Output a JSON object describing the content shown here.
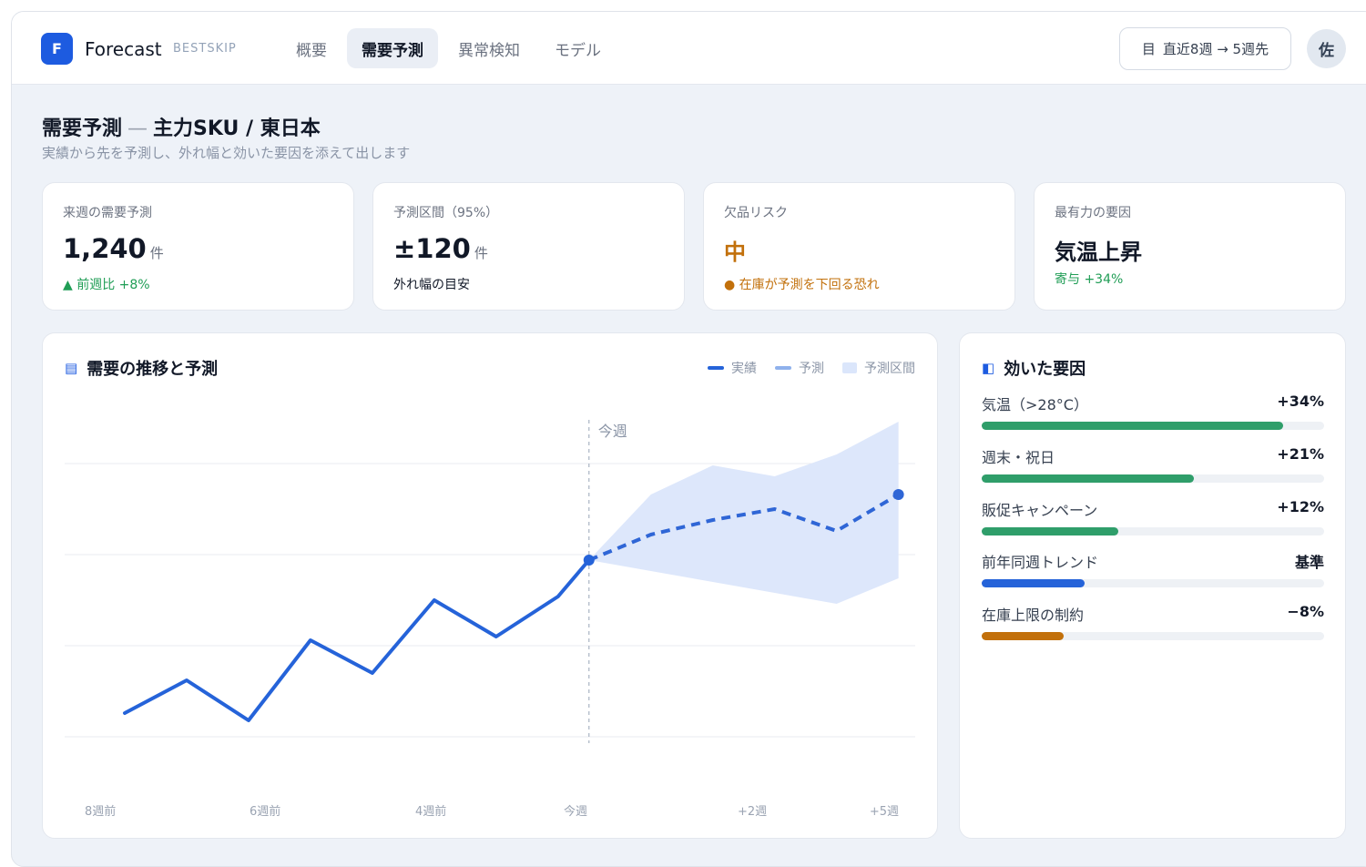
{
  "app": {
    "logo_letter": "F",
    "name": "Forecast",
    "subtitle": "BESTSKIP",
    "avatar": "佐"
  },
  "nav": {
    "tabs": [
      {
        "label": "概要",
        "active": false
      },
      {
        "label": "需要予測",
        "active": true
      },
      {
        "label": "異常検知",
        "active": false
      },
      {
        "label": "モデル",
        "active": false
      }
    ],
    "range_icon": "目",
    "range_label": "直近8週 → 5週先"
  },
  "page": {
    "title_main": "需要予測",
    "title_dash": "—",
    "title_scope": "主力SKU / 東日本",
    "subtitle": "実績から先を予測し、外れ幅と効いた要因を添えて出します"
  },
  "kpis": [
    {
      "label": "来週の需要予測",
      "value": "1,240",
      "unit": "件",
      "note": "▲ 前週比 +8%"
    },
    {
      "label": "予測区間（95%）",
      "value": "±120",
      "unit": "件",
      "note": "外れ幅の目安"
    },
    {
      "label": "欠品リスク",
      "value": "中",
      "note": "● 在庫が予測を下回る恐れ"
    },
    {
      "label": "最有力の要因",
      "value": "気温上昇",
      "note": "寄与 +34%"
    }
  ],
  "trend_panel": {
    "icon": "▤",
    "title": "需要の推移と予測",
    "legend": {
      "actual": "実績",
      "forecast": "予測",
      "interval": "予測区間"
    },
    "now_marker": "今週"
  },
  "factor_panel": {
    "icon": "◧",
    "title": "効いた要因",
    "items": [
      {
        "label": "気温（>28°C）",
        "value": "+34%",
        "fraction": 0.88,
        "color": "#2f9e6a"
      },
      {
        "label": "週末・祝日",
        "value": "+21%",
        "fraction": 0.62,
        "color": "#2f9e6a"
      },
      {
        "label": "販促キャンペーン",
        "value": "+12%",
        "fraction": 0.4,
        "color": "#2f9e6a"
      },
      {
        "label": "前年同週トレンド",
        "value": "基準",
        "fraction": 0.3,
        "color": "#2563d9"
      },
      {
        "label": "在庫上限の制約",
        "value": "−8%",
        "fraction": 0.24,
        "color": "#c2700b"
      }
    ]
  },
  "chart_data": {
    "type": "line",
    "title": "需要の推移と予測",
    "x_tick_labels": [
      "8週前",
      "6週前",
      "4週前",
      "今週",
      "+2週",
      "+5週"
    ],
    "x": [
      -8,
      -7,
      -6,
      -5,
      -4,
      -3,
      -2,
      -1,
      0,
      1,
      2,
      3,
      4,
      5
    ],
    "ylim": [
      0,
      100
    ],
    "grid": true,
    "legend_position": "top-right",
    "series": [
      {
        "name": "実績",
        "x": [
          -7.5,
          -6.5,
          -5.5,
          -4.5,
          -3.5,
          -2.5,
          -1.5,
          -0.5,
          0
        ],
        "values": [
          19,
          28,
          17,
          39,
          30,
          50,
          40,
          51,
          61
        ]
      },
      {
        "name": "予測",
        "x": [
          0,
          1,
          2,
          3,
          4,
          5
        ],
        "values": [
          61,
          68,
          72,
          75,
          69,
          79
        ]
      }
    ],
    "interval": {
      "name": "予測区間",
      "x": [
        0,
        1,
        2,
        3,
        4,
        5
      ],
      "upper": [
        61,
        79,
        87,
        84,
        90,
        99
      ],
      "lower": [
        61,
        58,
        55,
        52,
        49,
        56
      ]
    },
    "colors": {
      "actual": "#2563d9",
      "forecast": "#2f66d6",
      "interval": "#dde7fb"
    }
  }
}
